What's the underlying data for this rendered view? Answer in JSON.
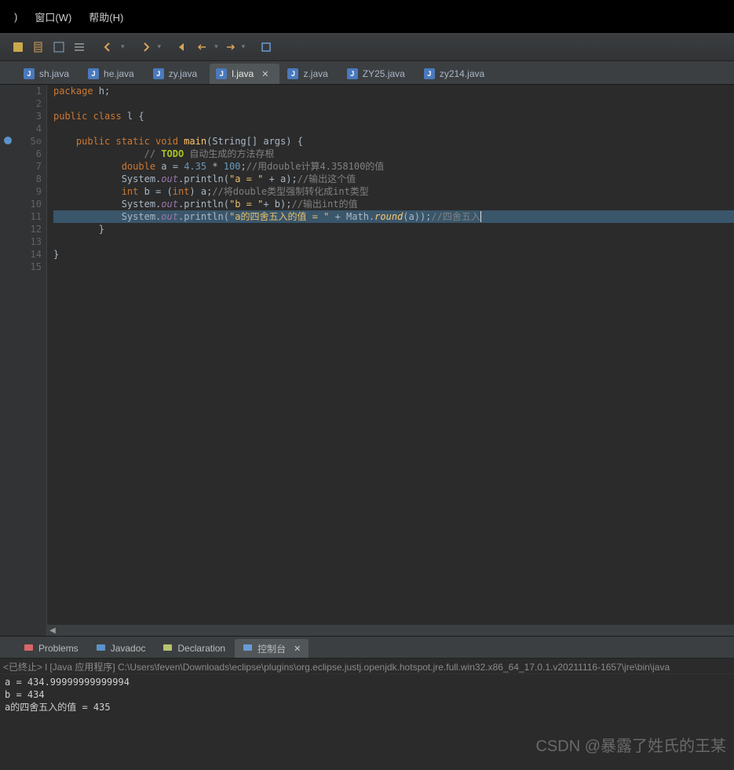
{
  "menubar": {
    "window": "窗口(W)",
    "help": "帮助(H)"
  },
  "tabs": [
    {
      "label": "sh.java",
      "active": false
    },
    {
      "label": "he.java",
      "active": false
    },
    {
      "label": "zy.java",
      "active": false
    },
    {
      "label": "l.java",
      "active": true,
      "closable": true
    },
    {
      "label": "z.java",
      "active": false
    },
    {
      "label": "ZY25.java",
      "active": false
    },
    {
      "label": "zy214.java",
      "active": false
    }
  ],
  "editor": {
    "lineNumbers": [
      "1",
      "2",
      "3",
      "4",
      "5⊖",
      "6",
      "7",
      "8",
      "9",
      "10",
      "11",
      "12",
      "13",
      "14",
      "15"
    ],
    "lines": [
      {
        "tokens": [
          {
            "t": "package ",
            "c": "kw"
          },
          {
            "t": "h;",
            "c": "ident"
          }
        ]
      },
      {
        "tokens": []
      },
      {
        "tokens": [
          {
            "t": "public class ",
            "c": "kw"
          },
          {
            "t": "l ",
            "c": "ident"
          },
          {
            "t": "{",
            "c": "ident"
          }
        ]
      },
      {
        "tokens": []
      },
      {
        "tokens": [
          {
            "t": "    public static void ",
            "c": "kw"
          },
          {
            "t": "main",
            "c": "cls"
          },
          {
            "t": "(",
            "c": "ident"
          },
          {
            "t": "String",
            "c": "ident"
          },
          {
            "t": "[] ",
            "c": "ident"
          },
          {
            "t": "args",
            "c": "ident"
          },
          {
            "t": ") {",
            "c": "ident"
          }
        ]
      },
      {
        "tokens": [
          {
            "t": "                // ",
            "c": "cmt"
          },
          {
            "t": "TODO",
            "c": "todo"
          },
          {
            "t": " 自动生成的方法存根",
            "c": "cmt"
          }
        ]
      },
      {
        "tokens": [
          {
            "t": "            ",
            "c": "ident"
          },
          {
            "t": "double ",
            "c": "kw"
          },
          {
            "t": "a = ",
            "c": "ident"
          },
          {
            "t": "4.35",
            "c": "num"
          },
          {
            "t": " * ",
            "c": "ident"
          },
          {
            "t": "100",
            "c": "num"
          },
          {
            "t": ";",
            "c": "ident"
          },
          {
            "t": "//用double计算4.358100的值",
            "c": "cmt"
          }
        ]
      },
      {
        "tokens": [
          {
            "t": "            System.",
            "c": "ident"
          },
          {
            "t": "out",
            "c": "fld"
          },
          {
            "t": ".println(",
            "c": "ident"
          },
          {
            "t": "\"a = \"",
            "c": "str"
          },
          {
            "t": " + a);",
            "c": "ident"
          },
          {
            "t": "//输出这个值",
            "c": "cmt"
          }
        ]
      },
      {
        "tokens": [
          {
            "t": "            ",
            "c": "ident"
          },
          {
            "t": "int ",
            "c": "kw"
          },
          {
            "t": "b = (",
            "c": "ident"
          },
          {
            "t": "int",
            "c": "kw"
          },
          {
            "t": ") a;",
            "c": "ident"
          },
          {
            "t": "//将double类型强制转化成int类型",
            "c": "cmt"
          }
        ]
      },
      {
        "tokens": [
          {
            "t": "            System.",
            "c": "ident"
          },
          {
            "t": "out",
            "c": "fld"
          },
          {
            "t": ".println(",
            "c": "ident"
          },
          {
            "t": "\"b = \"",
            "c": "str"
          },
          {
            "t": "+ b);",
            "c": "ident"
          },
          {
            "t": "//输出int的值",
            "c": "cmt"
          }
        ]
      },
      {
        "hl": true,
        "tokens": [
          {
            "t": "            System.",
            "c": "ident"
          },
          {
            "t": "out",
            "c": "fld"
          },
          {
            "t": ".println(",
            "c": "ident"
          },
          {
            "t": "\"a的四舍五入的值 = \"",
            "c": "str"
          },
          {
            "t": " + Math.",
            "c": "ident"
          },
          {
            "t": "round",
            "c": "mth"
          },
          {
            "t": "(a));",
            "c": "ident"
          },
          {
            "t": "//四舍五入",
            "c": "cmt"
          }
        ]
      },
      {
        "tokens": [
          {
            "t": "        }",
            "c": "ident"
          }
        ]
      },
      {
        "tokens": []
      },
      {
        "tokens": [
          {
            "t": "}",
            "c": "ident"
          }
        ]
      },
      {
        "tokens": []
      }
    ]
  },
  "panel": {
    "tabs": [
      {
        "label": "Problems",
        "iconColor": "#d96666"
      },
      {
        "label": "Javadoc",
        "iconColor": "#5b92c9"
      },
      {
        "label": "Declaration",
        "iconColor": "#b8c46f"
      },
      {
        "label": "控制台",
        "active": true,
        "closable": true,
        "iconColor": "#6a9bd8"
      }
    ],
    "header": "<已终止> l [Java 应用程序] C:\\Users\\feven\\Downloads\\eclipse\\plugins\\org.eclipse.justj.openjdk.hotspot.jre.full.win32.x86_64_17.0.1.v20211116-1657\\jre\\bin\\java",
    "output": [
      "a = 434.99999999999994",
      "b = 434",
      "a的四舍五入的值 = 435"
    ]
  },
  "watermark": "CSDN @暴露了姓氏的王某"
}
